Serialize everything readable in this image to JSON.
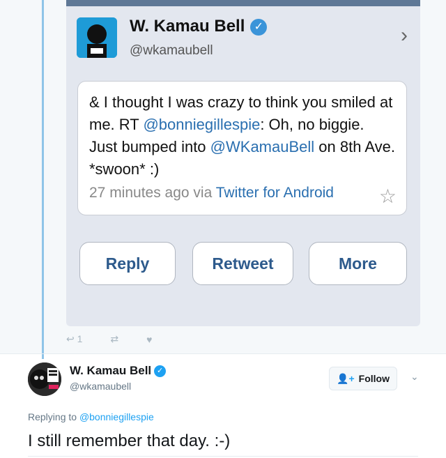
{
  "screenshot": {
    "name": "W. Kamau Bell",
    "handle": "@wkamaubell",
    "tweet_text_1": "& I thought I was crazy to think you smiled at me. RT ",
    "mention_1": "@bonniegillespie",
    "tweet_text_2": ": Oh, no biggie. Just bumped into ",
    "mention_2": "@WKamauBell",
    "tweet_text_3": " on 8th Ave. *swoon* :)",
    "meta_time": "27 minutes ago via ",
    "meta_source": "Twitter for Android",
    "buttons": {
      "reply": "Reply",
      "retweet": "Retweet",
      "more": "More"
    }
  },
  "parent_actions": {
    "reply_count": "1"
  },
  "reply_tweet": {
    "name": "W. Kamau Bell",
    "handle": "@wkamaubell",
    "follow_label": "Follow",
    "replying_prefix": "Replying to ",
    "replying_to": "@bonniegillespie",
    "text": "I still remember that day. :-)"
  },
  "colors": {
    "thread_line": "#8fc4e8",
    "twitter_blue": "#1da1f2",
    "ios_link_blue": "#2a6fb0",
    "ios_button_text": "#2d5a8c"
  },
  "icons": {
    "verified": "verified-badge-icon",
    "chevron": "chevron-right-icon",
    "star": "favorite-star-icon",
    "reply": "reply-icon",
    "retweet": "retweet-icon",
    "like": "heart-icon",
    "follow": "add-user-icon",
    "caret": "chevron-down-icon"
  }
}
